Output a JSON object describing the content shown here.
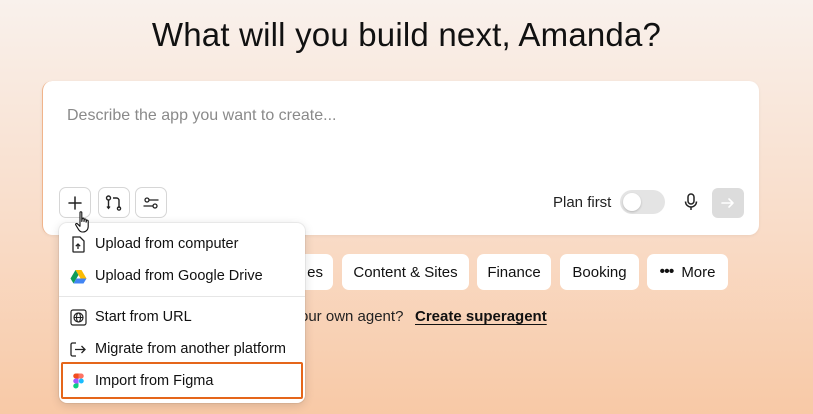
{
  "header": {
    "title": "What will you build next, Amanda?"
  },
  "prompt": {
    "placeholder": "Describe the app you want to create...",
    "value": "",
    "plan_first_label": "Plan first",
    "plan_first_enabled": false
  },
  "toolbar": {
    "buttons": [
      {
        "icon": "plus-icon"
      },
      {
        "icon": "flow-icon"
      },
      {
        "icon": "sliders-icon"
      }
    ],
    "mic_icon": "microphone-icon",
    "send_icon": "arrow-right-icon"
  },
  "chips": [
    {
      "label": "es"
    },
    {
      "label": "Content & Sites"
    },
    {
      "label": "Finance"
    },
    {
      "label": "Booking"
    },
    {
      "label": "More",
      "icon": "ellipsis-icon"
    }
  ],
  "footer": {
    "text": "our own agent?",
    "link": "Create superagent"
  },
  "dropdown": {
    "items": [
      {
        "label": "Upload from computer",
        "icon": "file-upload-icon"
      },
      {
        "label": "Upload from Google Drive",
        "icon": "google-drive-icon"
      },
      {
        "label": "Start from URL",
        "icon": "globe-icon"
      },
      {
        "label": "Migrate from another platform",
        "icon": "migrate-icon"
      },
      {
        "label": "Import from Figma",
        "icon": "figma-icon",
        "highlighted": true
      }
    ]
  },
  "colors": {
    "highlight": "#e5661a",
    "background_top": "#f9f1ec",
    "background_bottom": "#f8c9a6",
    "toggle_off": "#e4e4e4",
    "send_disabled": "#dcdcdc"
  }
}
